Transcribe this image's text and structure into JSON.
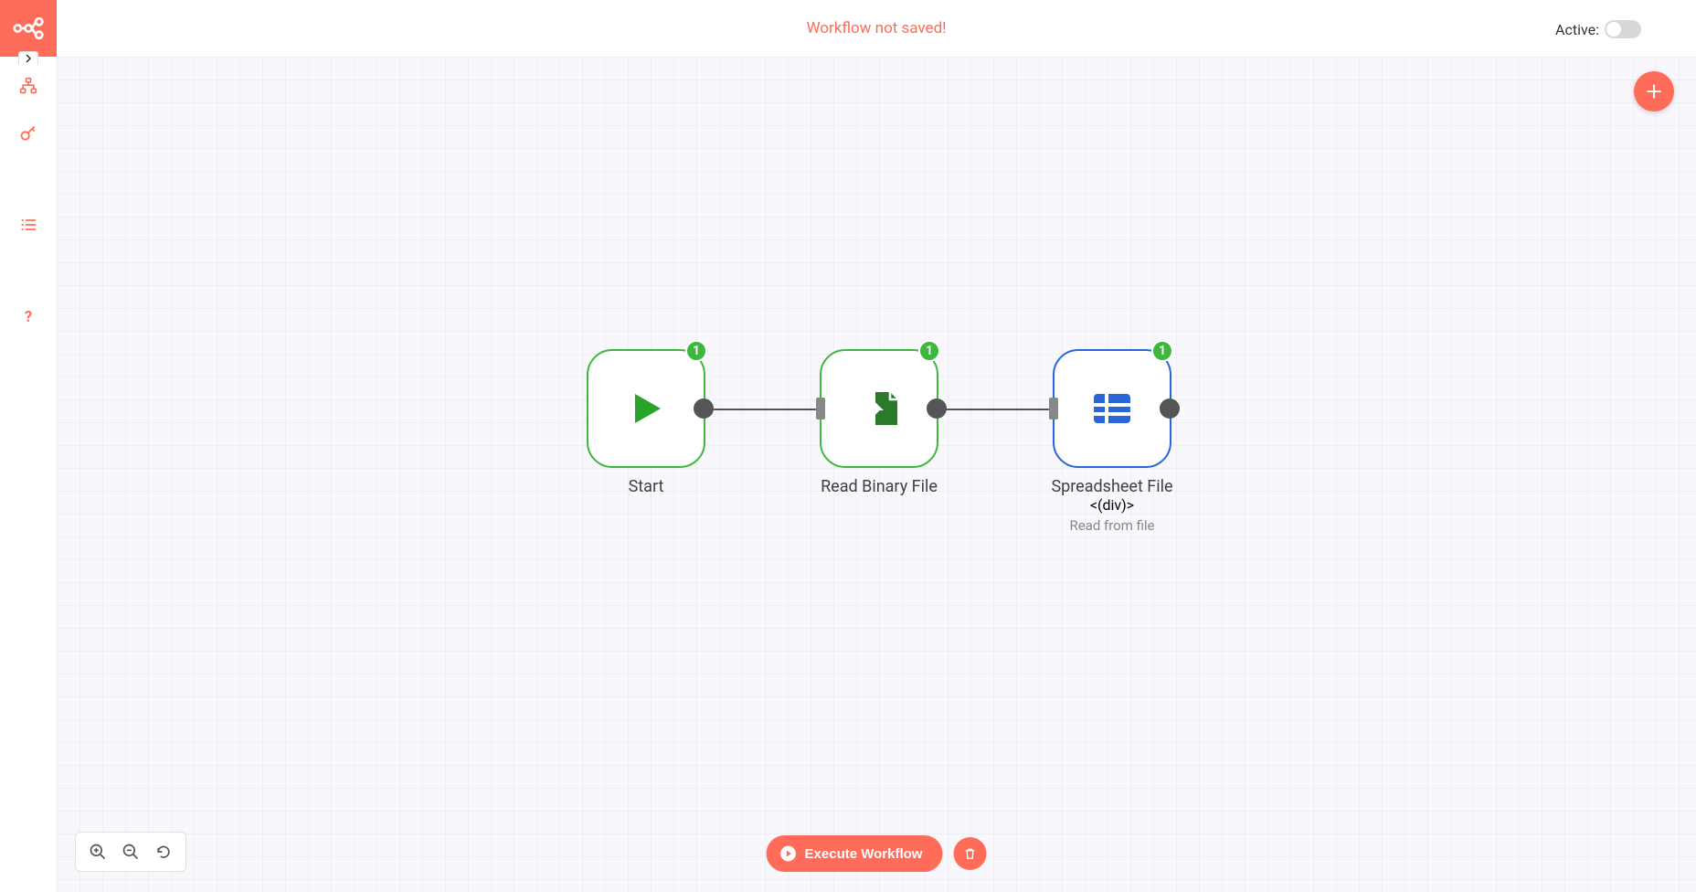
{
  "header": {
    "status": "Workflow not saved!",
    "active_label": "Active:"
  },
  "nodes": [
    {
      "label": "Start",
      "sublabel": "",
      "badge": "1"
    },
    {
      "label": "Read Binary File",
      "sublabel": "",
      "badge": "1"
    },
    {
      "label": "Spreadsheet File",
      "sublabel": "Read from file",
      "badge": "1"
    }
  ],
  "controls": {
    "execute_label": "Execute Workflow"
  },
  "colors": {
    "accent": "#ff6d5a",
    "node_green": "#3fb73f",
    "node_blue": "#2a66d8"
  }
}
